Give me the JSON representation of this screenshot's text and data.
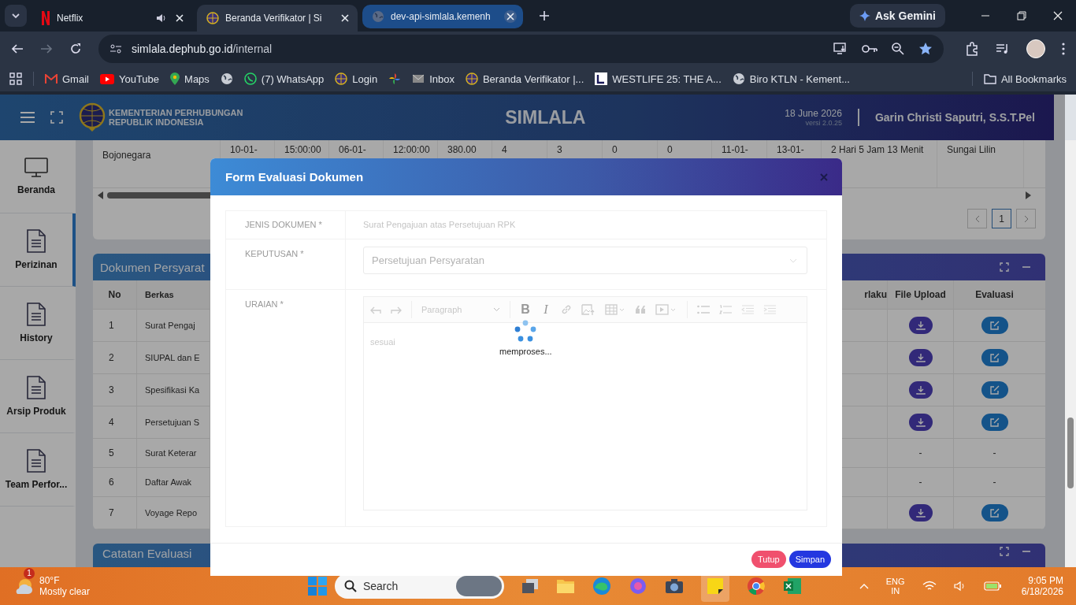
{
  "browser": {
    "tabs": [
      {
        "title": "Netflix",
        "kind": "netflix",
        "audio": true,
        "selected": false,
        "hovered": false
      },
      {
        "title": "Beranda Verifikator | Si",
        "kind": "site",
        "audio": false,
        "selected": true,
        "hovered": false
      },
      {
        "title": "dev-api-simlala.kemenh",
        "kind": "globe",
        "audio": false,
        "selected": false,
        "hovered": true
      }
    ],
    "gemini": "Ask Gemini",
    "url_host": "simlala.dephub.go.id",
    "url_path": "/internal",
    "bookmarks": [
      {
        "label": "Gmail",
        "kind": "gmail"
      },
      {
        "label": "YouTube",
        "kind": "youtube"
      },
      {
        "label": "Maps",
        "kind": "maps"
      },
      {
        "kind": "globe"
      },
      {
        "label": "(7) WhatsApp",
        "kind": "whatsapp"
      },
      {
        "label": "Login",
        "kind": "site"
      },
      {
        "kind": "pinwheel"
      },
      {
        "label": "Inbox",
        "kind": "mail"
      },
      {
        "label": "Beranda Verifikator |...",
        "kind": "site"
      },
      {
        "label": "WESTLIFE 25: THE A...",
        "kind": "square"
      },
      {
        "label": "Biro KTLN - Kement...",
        "kind": "globe"
      }
    ],
    "all_bookmarks": "All Bookmarks"
  },
  "header": {
    "org_line_1": "KEMENTERIAN PERHUBUNGAN",
    "org_line_2": "REPUBLIK INDONESIA",
    "app_name": "SIMLALA",
    "date": "18 June 2026",
    "version": "versi 2.0.25",
    "user": "Garin Christi Saputri, S.S.T.Pel"
  },
  "sidebar": [
    {
      "label": "Beranda",
      "kind": "monitor",
      "selected": false
    },
    {
      "label": "Perizinan",
      "kind": "doc",
      "selected": true
    },
    {
      "label": "History",
      "kind": "doc",
      "selected": false
    },
    {
      "label": "Arsip Produk",
      "kind": "doc",
      "selected": false
    },
    {
      "label": "Team Perfor...",
      "kind": "doc",
      "selected": false
    }
  ],
  "trip_table": {
    "cells": [
      "Bojonegara",
      "10-01-",
      "15:00:00",
      "06-01-",
      "12:00:00",
      "380.00",
      "4",
      "3",
      "0",
      "0",
      "11-01-",
      "13-01-",
      "2 Hari 5 Jam 13 Menit",
      "Sungai Lilin"
    ]
  },
  "pagination": {
    "pages": [
      {
        "label": "1",
        "selected": true
      }
    ]
  },
  "documents": {
    "title": "Dokumen Persyarat",
    "columns": [
      "No",
      "Berkas",
      "rlaku",
      "File Upload",
      "Evaluasi"
    ],
    "rows": [
      {
        "no": "1",
        "berkas": "Surat Pengaj",
        "uploaded": true
      },
      {
        "no": "2",
        "berkas": "SIUPAL dan E",
        "uploaded": true
      },
      {
        "no": "3",
        "berkas": "Spesifikasi Ka",
        "uploaded": true
      },
      {
        "no": "4",
        "berkas": "Persetujuan S",
        "uploaded": true
      },
      {
        "no": "5",
        "berkas": "Surat Keterar",
        "uploaded": false,
        "file_cell": "-",
        "eval_cell": "-"
      },
      {
        "no": "6",
        "berkas": "Daftar Awak",
        "uploaded": false,
        "file_cell": "-",
        "eval_cell": "-"
      },
      {
        "no": "7",
        "berkas": "Voyage Repo",
        "uploaded": true
      }
    ]
  },
  "notes_panel": {
    "title": "Catatan Evaluasi"
  },
  "modal": {
    "title": "Form Evaluasi Dokumen",
    "fields": [
      {
        "label": "JENIS DOKUMEN *",
        "kind": "text",
        "value": "Surat Pengajuan atas Persetujuan RPK"
      },
      {
        "label": "KEPUTUSAN *",
        "kind": "select",
        "value": "Persetujuan Persyaratan"
      },
      {
        "label": "URAIAN *",
        "kind": "editor",
        "value": "sesuai",
        "style": "Paragraph",
        "bold": "B",
        "italic": "I"
      }
    ],
    "loading_text": "memproses...",
    "buttons": [
      {
        "label": "Tutup",
        "kind": "cancel"
      },
      {
        "label": "Simpan",
        "kind": "primary"
      }
    ]
  },
  "taskbar": {
    "badge": "1",
    "temperature": "80°F",
    "weather": "Mostly clear",
    "search_placeholder": "Search",
    "language": "ENG",
    "region": "IN",
    "time": "9:05 PM",
    "date": "6/18/2026"
  }
}
